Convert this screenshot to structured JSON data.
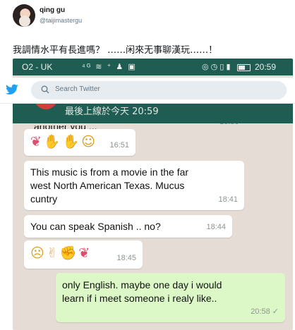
{
  "tweet": {
    "author_name": "qing gu",
    "author_handle": "@taijimastergu",
    "text": "我調情水平有長進嗎？ ……闲來无事聊漢玩……！"
  },
  "phone": {
    "statusbar": {
      "carrier": "O2 - UK",
      "time": "20:59"
    },
    "chat_header": {
      "last_seen": "最後上線於今天 20:59"
    },
    "messages": [
      {
        "id": "m0",
        "direction": "in",
        "text": "another you ...",
        "time": "16:50"
      },
      {
        "id": "m1",
        "direction": "in",
        "emojis": [
          "tulip",
          "pray",
          "pray",
          "star-struck"
        ],
        "time": "16:51"
      },
      {
        "id": "m2",
        "direction": "in",
        "lines": [
          "This music is from a movie in the far",
          "west North American Texas. Mucus",
          "cuntry"
        ],
        "time": "18:41"
      },
      {
        "id": "m3",
        "direction": "in",
        "text": "You can speak Spanish .. no?",
        "time": "18:44"
      },
      {
        "id": "m4",
        "direction": "in",
        "emojis": [
          "flushed",
          "raising-hands",
          "thumbs-up",
          "tulip"
        ],
        "time": "18:45"
      },
      {
        "id": "m5",
        "direction": "out",
        "lines": [
          "only English.  maybe one day i would",
          "learn if i meet     someone i realy like.."
        ],
        "time": "20:58",
        "status": "sent-tick"
      }
    ]
  },
  "twitter_bar": {
    "search_placeholder": "Search Twitter"
  },
  "colors": {
    "whatsapp_green": "#1f5d52",
    "chat_bg": "#e5ddd5",
    "outgoing_bubble": "#dcf8c6",
    "twitter_blue": "#1da1f2"
  }
}
